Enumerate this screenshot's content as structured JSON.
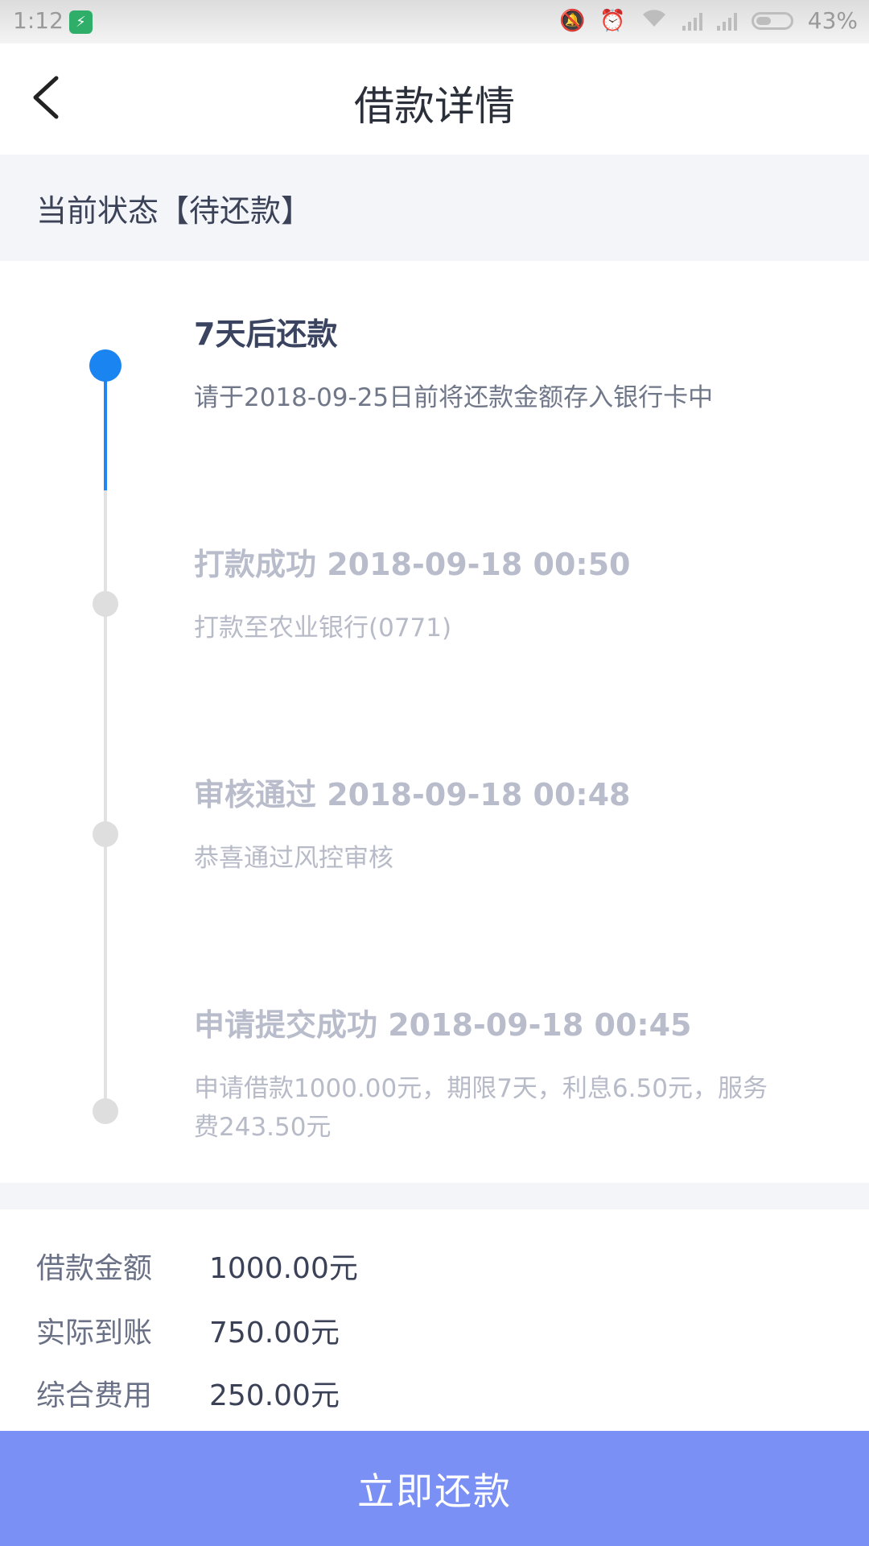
{
  "status_bar": {
    "time": "1:12",
    "battery": "43%"
  },
  "header": {
    "title": "借款详情"
  },
  "status_banner": {
    "text": "当前状态【待还款】"
  },
  "timeline": [
    {
      "title": "7天后还款",
      "desc": "请于2018-09-25日前将还款金额存入银行卡中",
      "state": "active"
    },
    {
      "title": "打款成功 2018-09-18 00:50",
      "desc": "打款至农业银行(0771)",
      "state": "done"
    },
    {
      "title": "审核通过 2018-09-18 00:48",
      "desc": "恭喜通过风控审核",
      "state": "done"
    },
    {
      "title": "申请提交成功 2018-09-18 00:45",
      "desc": "申请借款1000.00元，期限7天，利息6.50元，服务费243.50元",
      "state": "done"
    }
  ],
  "summary": [
    {
      "label": "借款金额",
      "value": "1000.00元"
    },
    {
      "label": "实际到账",
      "value": "750.00元"
    },
    {
      "label": "综合费用",
      "value": "250.00元"
    }
  ],
  "repay_button": {
    "label": "立即还款"
  },
  "colors": {
    "accent": "#1a84f0",
    "button": "#7a90f4",
    "banner_bg": "#f3f5f9"
  }
}
